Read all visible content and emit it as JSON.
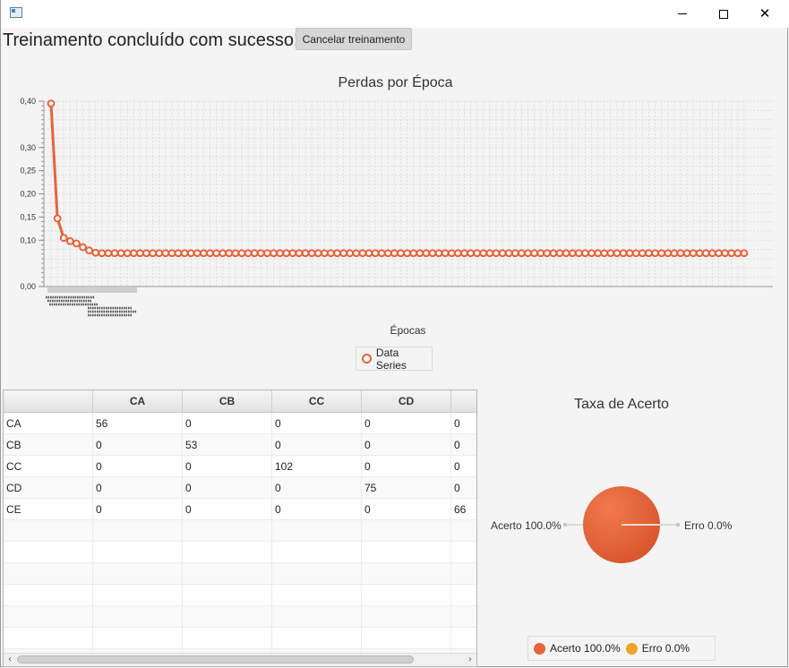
{
  "window": {
    "title": ""
  },
  "status_text": "Treinamento concluído com sucesso!",
  "cancel_button": "Cancelar treinamento",
  "loss_chart": {
    "title": "Perdas por Época",
    "x_axis_label": "Épocas",
    "legend": "Data Series",
    "y_ticks": [
      "0,40",
      "0,30",
      "0,25",
      "0,20",
      "0,15",
      "0,10",
      "0,00"
    ],
    "color": "#e8623a"
  },
  "chart_data": {
    "type": "line",
    "title": "Perdas por Época",
    "xlabel": "Épocas",
    "ylabel": "",
    "ylim": [
      0,
      0.4
    ],
    "grid": true,
    "legend_placement": "bottom",
    "series": [
      {
        "name": "Data Series",
        "values": [
          0.395,
          0.147,
          0.105,
          0.098,
          0.093,
          0.085,
          0.078,
          0.073,
          0.072,
          0.072,
          0.072,
          0.072,
          0.072,
          0.072,
          0.072,
          0.072,
          0.072,
          0.072,
          0.072,
          0.072,
          0.072,
          0.072,
          0.072,
          0.072,
          0.072,
          0.072,
          0.072,
          0.072,
          0.072,
          0.072,
          0.072,
          0.072,
          0.072,
          0.072,
          0.072,
          0.072,
          0.072,
          0.072,
          0.072,
          0.072,
          0.072,
          0.072,
          0.072,
          0.072,
          0.072,
          0.072,
          0.072,
          0.072,
          0.072,
          0.072,
          0.072,
          0.072,
          0.072,
          0.072,
          0.072,
          0.072,
          0.072,
          0.072,
          0.072,
          0.072,
          0.072,
          0.072,
          0.072,
          0.072,
          0.072,
          0.072,
          0.072,
          0.072,
          0.072,
          0.072,
          0.072,
          0.072,
          0.072,
          0.072,
          0.072,
          0.072,
          0.072,
          0.072,
          0.072,
          0.072,
          0.072,
          0.072,
          0.072,
          0.072,
          0.072,
          0.072,
          0.072,
          0.072,
          0.072,
          0.072,
          0.072,
          0.072,
          0.072,
          0.072,
          0.072,
          0.072,
          0.072,
          0.072,
          0.072,
          0.072,
          0.072,
          0.072,
          0.072,
          0.072,
          0.072,
          0.072,
          0.072,
          0.072,
          0.072,
          0.072
        ]
      }
    ]
  },
  "confusion_matrix": {
    "columns": [
      "",
      "CA",
      "CB",
      "CC",
      "CD",
      ""
    ],
    "rows": [
      [
        "CA",
        "56",
        "0",
        "0",
        "0",
        "0"
      ],
      [
        "CB",
        "0",
        "53",
        "0",
        "0",
        "0"
      ],
      [
        "CC",
        "0",
        "0",
        "102",
        "0",
        "0"
      ],
      [
        "CD",
        "0",
        "0",
        "0",
        "75",
        "0"
      ],
      [
        "CE",
        "0",
        "0",
        "0",
        "0",
        "66"
      ]
    ],
    "empty_rows": 7
  },
  "accuracy_chart": {
    "title": "Taxa de Acerto",
    "slice_label_acerto": "Acerto 100.0%",
    "slice_label_erro": "Erro 0.0%",
    "legend_acerto": "Acerto 100.0%",
    "legend_erro": "Erro 0.0%",
    "colors": {
      "acerto": "#e8623a",
      "erro": "#f0a22a"
    },
    "acerto_pct": 100.0,
    "erro_pct": 0.0
  }
}
